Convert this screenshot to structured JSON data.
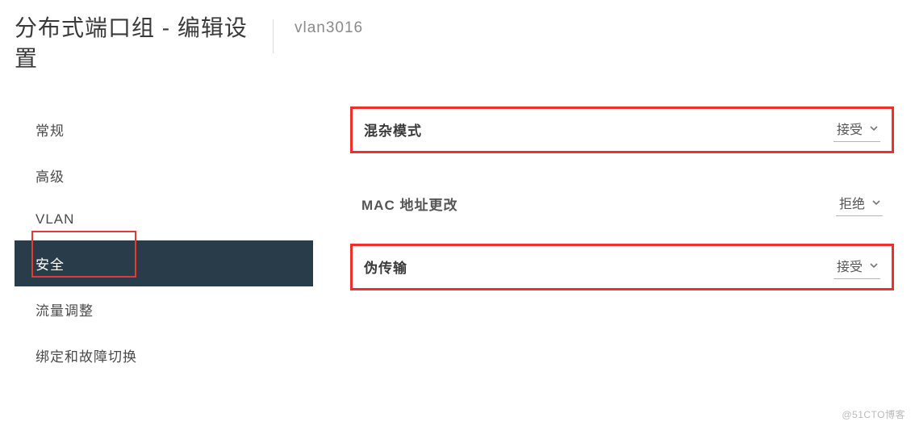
{
  "header": {
    "title": "分布式端口组 - 编辑设置",
    "subtitle": "vlan3016"
  },
  "sidebar": {
    "items": [
      {
        "label": "常规"
      },
      {
        "label": "高级"
      },
      {
        "label": "VLAN"
      },
      {
        "label": "安全"
      },
      {
        "label": "流量调整"
      },
      {
        "label": "绑定和故障切换"
      }
    ],
    "activeIndex": 3
  },
  "main": {
    "rows": [
      {
        "label": "混杂模式",
        "value": "接受",
        "highlight": true,
        "bold": true
      },
      {
        "label": "MAC 地址更改",
        "value": "拒绝",
        "highlight": false,
        "bold": false
      },
      {
        "label": "伪传输",
        "value": "接受",
        "highlight": true,
        "bold": true
      }
    ]
  },
  "watermark": "@51CTO博客"
}
